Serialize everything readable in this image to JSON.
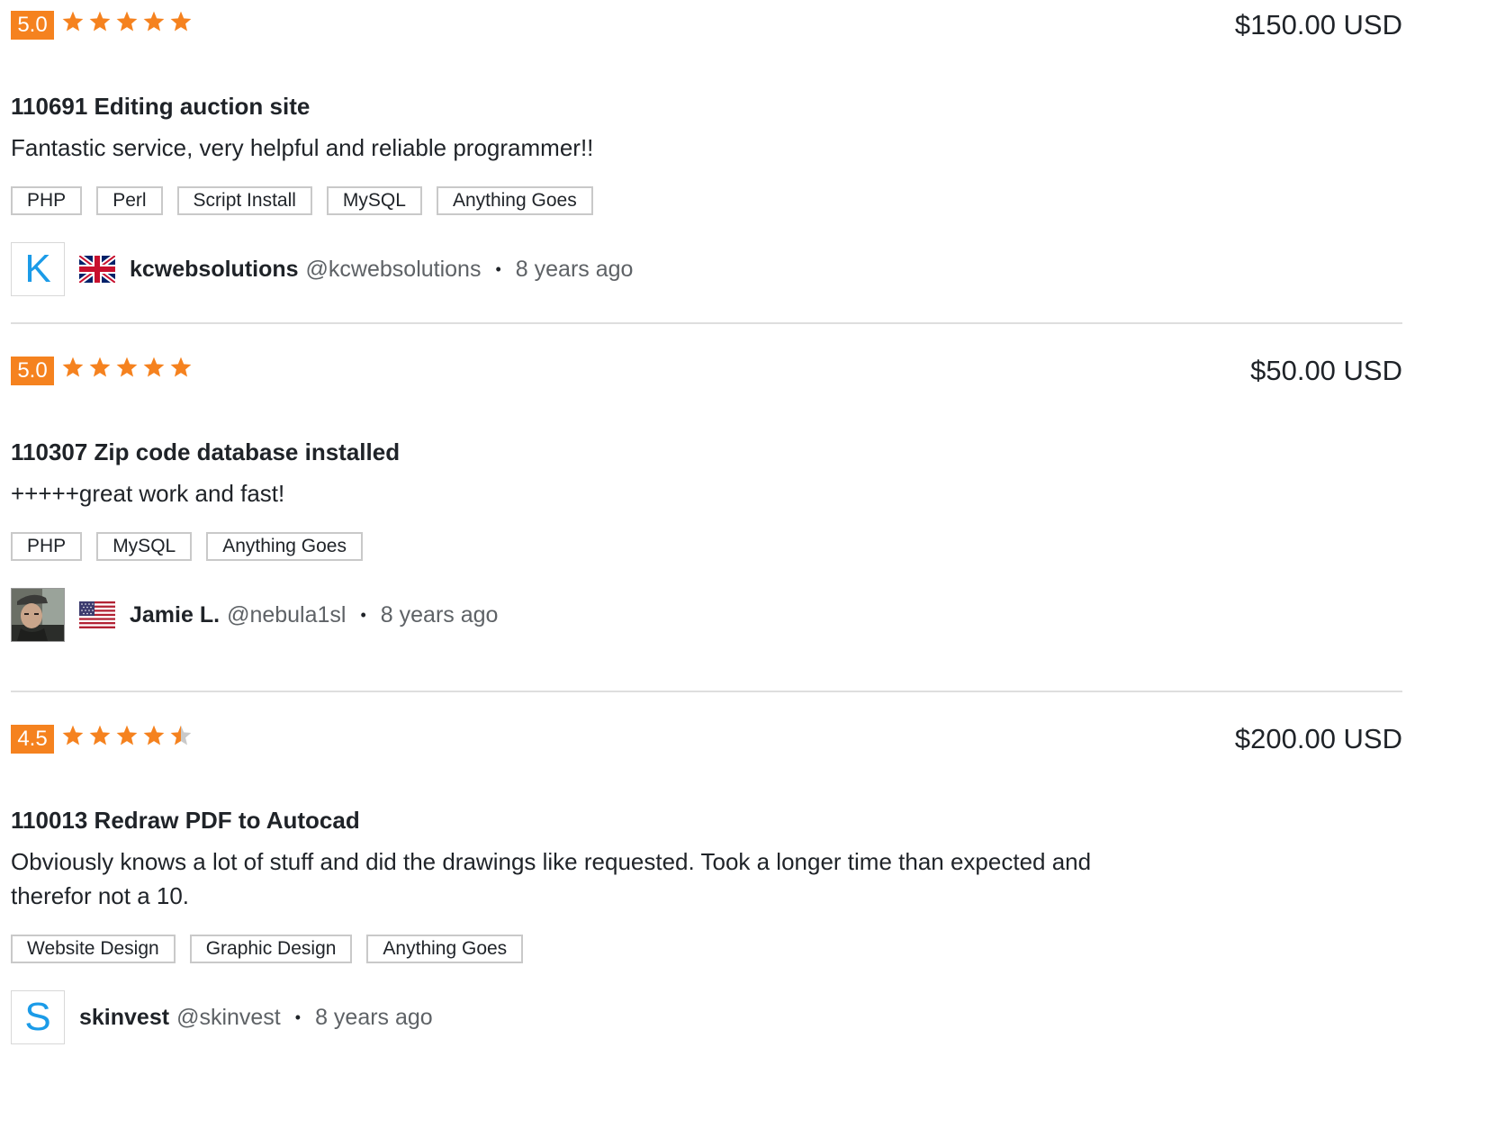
{
  "reviews": [
    {
      "rating": "5.0",
      "stars": 5,
      "price": "$150.00 USD",
      "title": "110691 Editing auction site",
      "comment": "Fantastic service, very helpful and reliable programmer!!",
      "tags": [
        "PHP",
        "Perl",
        "Script Install",
        "MySQL",
        "Anything Goes"
      ],
      "avatar_letter": "K",
      "flag": "uk-flag",
      "username": "kcwebsolutions",
      "handle": "@kcwebsolutions",
      "separator": "•",
      "time": "8 years ago"
    },
    {
      "rating": "5.0",
      "stars": 5,
      "price": "$50.00 USD",
      "title": "110307 Zip code database installed",
      "comment": "+++++great work and fast!",
      "tags": [
        "PHP",
        "MySQL",
        "Anything Goes"
      ],
      "avatar_letter": "",
      "flag": "us-flag",
      "username": "Jamie L.",
      "handle": "@nebula1sl",
      "separator": "•",
      "time": "8 years ago"
    },
    {
      "rating": "4.5",
      "stars": 4.5,
      "price": "$200.00 USD",
      "title": "110013 Redraw PDF to Autocad",
      "comment": "Obviously knows a lot of stuff and did the drawings like requested. Took a longer time than expected and therefor not a 10.",
      "tags": [
        "Website Design",
        "Graphic Design",
        "Anything Goes"
      ],
      "avatar_letter": "S",
      "flag": "",
      "username": "skinvest",
      "handle": "@skinvest",
      "separator": "•",
      "time": "8 years ago"
    }
  ],
  "colors": {
    "accent": "#f5821f",
    "star_empty": "#c9c9c9",
    "avatar_letter": "#1b9be8",
    "text": "#1f2328",
    "muted": "#5e6266"
  }
}
